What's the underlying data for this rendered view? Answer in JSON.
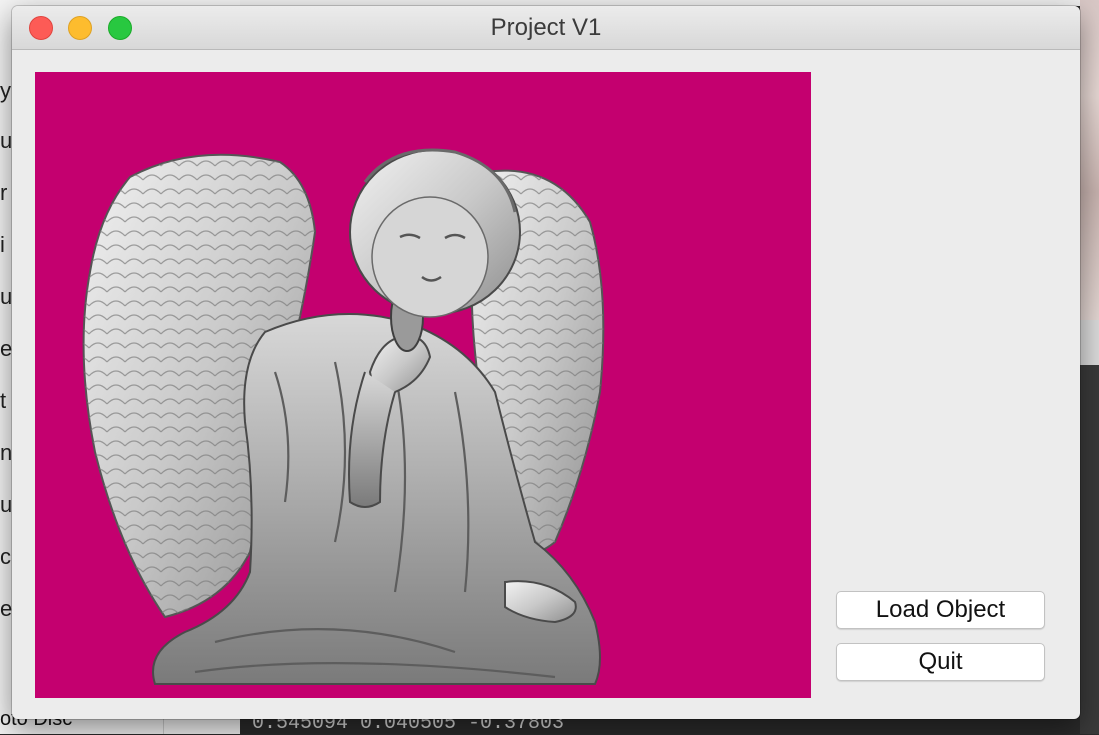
{
  "window": {
    "title": "Project V1"
  },
  "viewport": {
    "background_color": "#c4006f",
    "content": "angel-statue-3d-model"
  },
  "buttons": {
    "load_label": "Load Object",
    "quit_label": "Quit"
  },
  "background": {
    "sidebar_fragments": [
      "y",
      "u",
      "r",
      "i",
      "u",
      "e",
      "t",
      "n",
      "u",
      "c",
      "e"
    ],
    "sidebar_bottom_text": "oto Disc",
    "terminal_text": "0.545094 0.040505 -0.37803"
  },
  "colors": {
    "close": "#fd5b56",
    "minimize": "#fdbc2e",
    "zoom": "#28c840",
    "viewport_bg": "#c4006f"
  }
}
